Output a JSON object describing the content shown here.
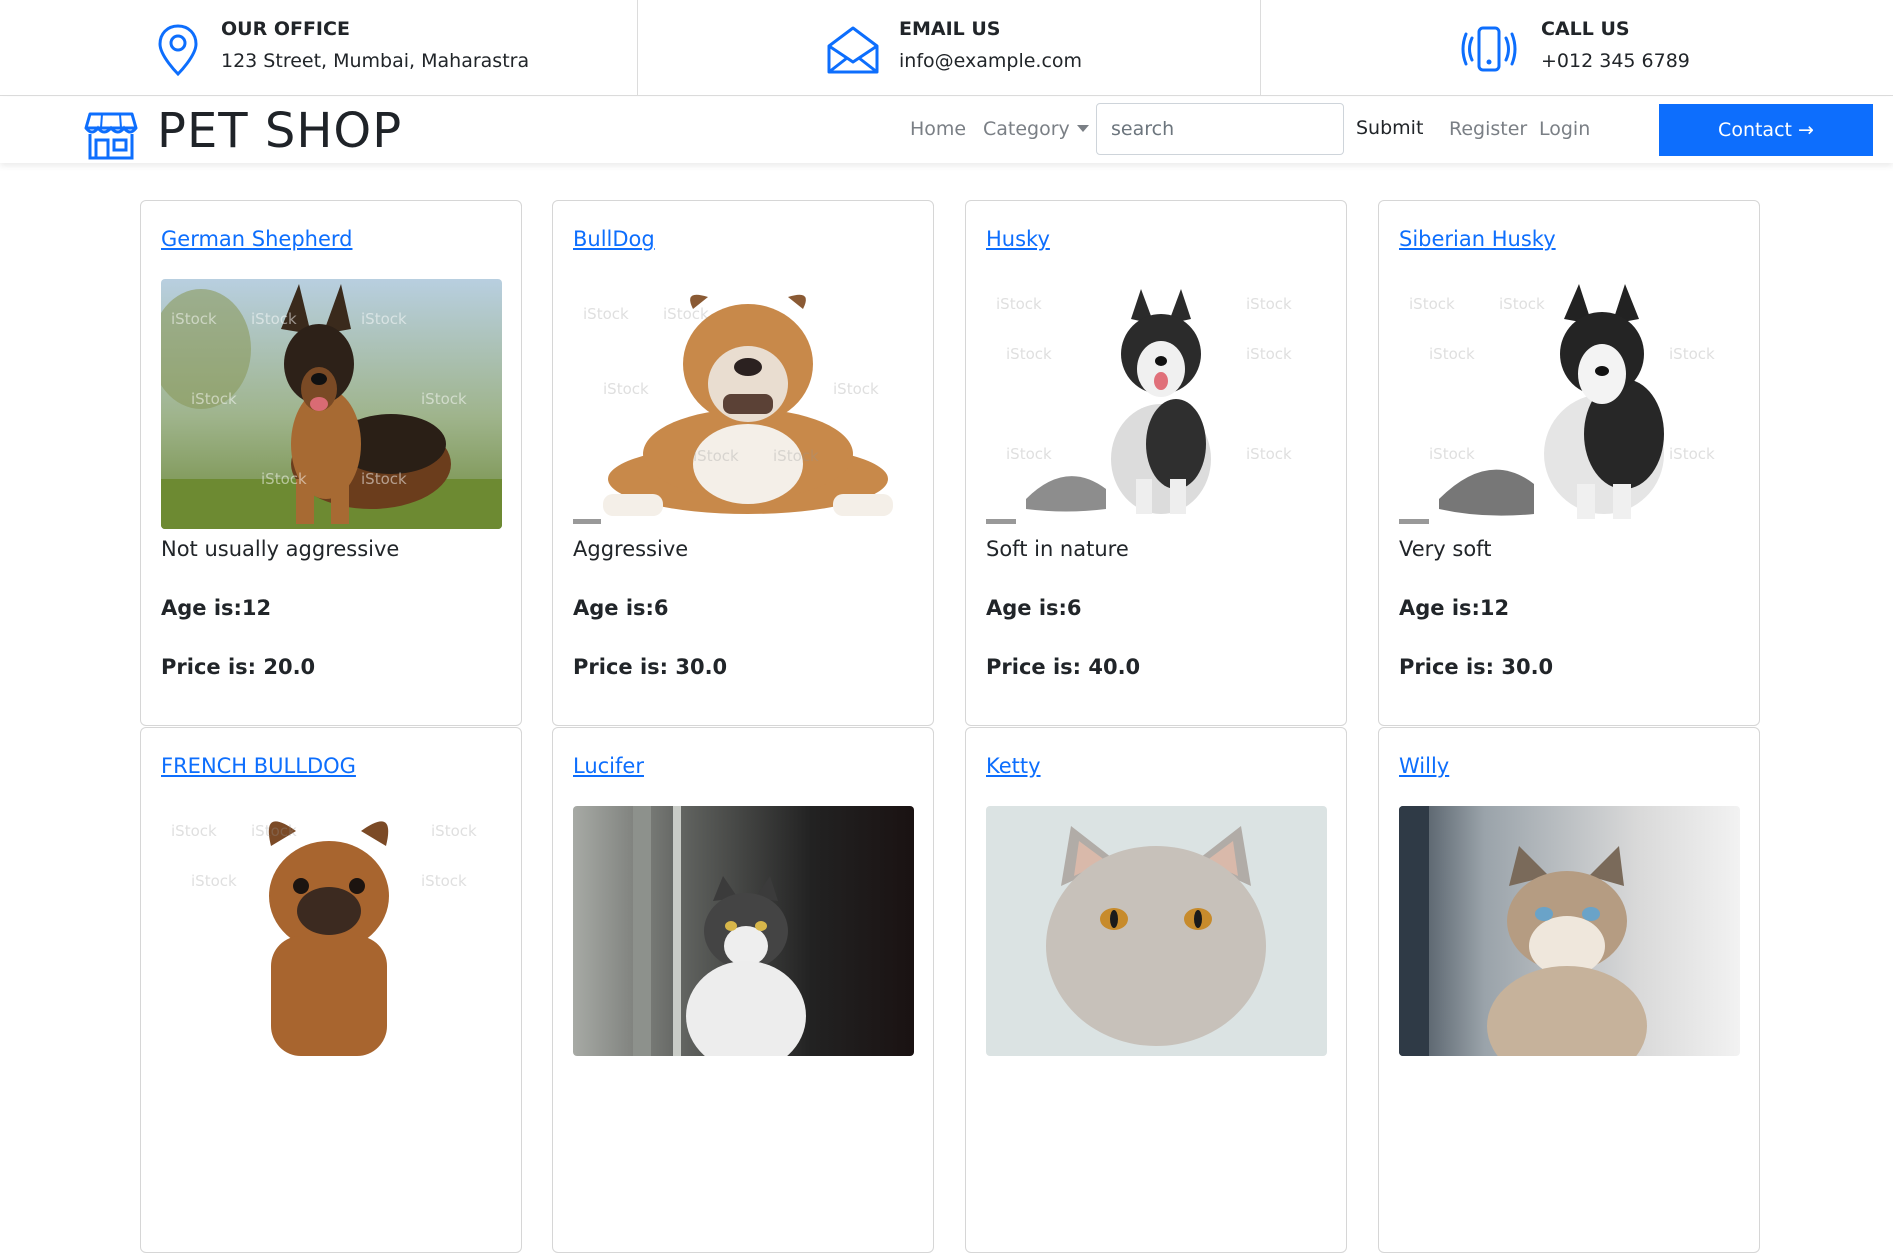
{
  "topbar": {
    "office": {
      "heading": "OUR OFFICE",
      "text": "123 Street, Mumbai, Maharastra",
      "icon": "map-pin-icon"
    },
    "email": {
      "heading": "EMAIL US",
      "text": "info@example.com",
      "icon": "envelope-open-icon"
    },
    "call": {
      "heading": "CALL US",
      "text": "+012 345 6789",
      "icon": "phone-vibrate-icon"
    }
  },
  "navbar": {
    "brand": "PET SHOP",
    "brand_icon": "shop-icon",
    "home": "Home",
    "category": "Category",
    "search_placeholder": "search",
    "submit": "Submit",
    "register": "Register",
    "login": "Login",
    "contact": "Contact →"
  },
  "colors": {
    "primary": "#0d6efd",
    "text": "#212529",
    "muted": "#7a7f85"
  },
  "cards": [
    {
      "title": "German Shepherd",
      "desc": "Not usually aggressive",
      "age": "Age is:12",
      "price": "Price is: 20.0",
      "image": "german-shepherd"
    },
    {
      "title": "BullDog",
      "desc": "Aggressive",
      "age": "Age is:6",
      "price": "Price is: 30.0",
      "image": "bulldog"
    },
    {
      "title": "Husky",
      "desc": "Soft in nature",
      "age": "Age is:6",
      "price": "Price is: 40.0",
      "image": "husky"
    },
    {
      "title": "Siberian Husky",
      "desc": "Very soft",
      "age": "Age is:12",
      "price": "Price is: 30.0",
      "image": "siberian-husky"
    },
    {
      "title": "FRENCH BULLDOG",
      "image": "french-bulldog"
    },
    {
      "title": "Lucifer",
      "image": "cat-lucifer"
    },
    {
      "title": "Ketty",
      "image": "cat-ketty"
    },
    {
      "title": "Willy",
      "image": "cat-willy"
    }
  ]
}
